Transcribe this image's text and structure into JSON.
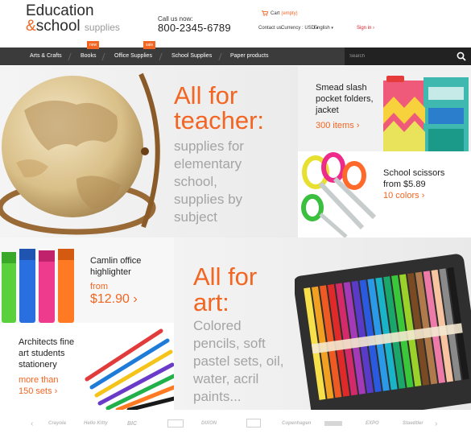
{
  "header": {
    "logo_line1": "Education",
    "logo_amp": "&",
    "logo_line2": "school",
    "logo_sub": "supplies",
    "call_label": "Call us now:",
    "phone": "800-2345-6789",
    "cart_label": "Cart",
    "cart_status": "(empty)",
    "contact_us": "Contact us",
    "currency": "Currency : USD",
    "language": "English",
    "sign_in": "Sign in"
  },
  "nav": {
    "items": [
      {
        "label": "Arts & Crafts"
      },
      {
        "label": "Books",
        "badge": "new"
      },
      {
        "label": "Office Supplies",
        "badge": "sale"
      },
      {
        "label": "School Supplies"
      },
      {
        "label": "Paper products"
      }
    ],
    "search_placeholder": "Search"
  },
  "banners": {
    "teacher": {
      "title_line1": "All for",
      "title_line2": "teacher:",
      "sub_lines": [
        "supplies for",
        "elementary",
        "school,",
        "supplies by",
        "subject"
      ]
    },
    "smead": {
      "lines": [
        "Smead slash",
        "pocket folders,",
        "jacket"
      ],
      "link": "300 items ›"
    },
    "scissors": {
      "lines": [
        "School scissors",
        "from $5.89"
      ],
      "link": "10 colors ›"
    },
    "camlin": {
      "lines": [
        "Camlin office",
        "highlighter"
      ],
      "from": "from",
      "price": "$12.90 ›"
    },
    "art": {
      "title_line1": "All for",
      "title_line2": "art:",
      "sub_lines": [
        "Colored",
        "pencils, soft",
        "pastel sets, oil,",
        "water, acril",
        "paints..."
      ]
    },
    "architects": {
      "lines": [
        "Architects fine",
        "art students",
        "stationery"
      ],
      "link_lines": [
        "more than",
        "150 sets ›"
      ]
    }
  },
  "brands": {
    "prev": "‹",
    "next": "›",
    "items": [
      "Crayola",
      "Hello Kitty",
      "BIC",
      "",
      "DIXON",
      "",
      "Copenhagen",
      "",
      "EXPO",
      "Staedtler"
    ]
  },
  "colors": {
    "accent": "#f26522",
    "nav_bg": "#3b3b3b",
    "gray_text": "#a4a4a4"
  }
}
